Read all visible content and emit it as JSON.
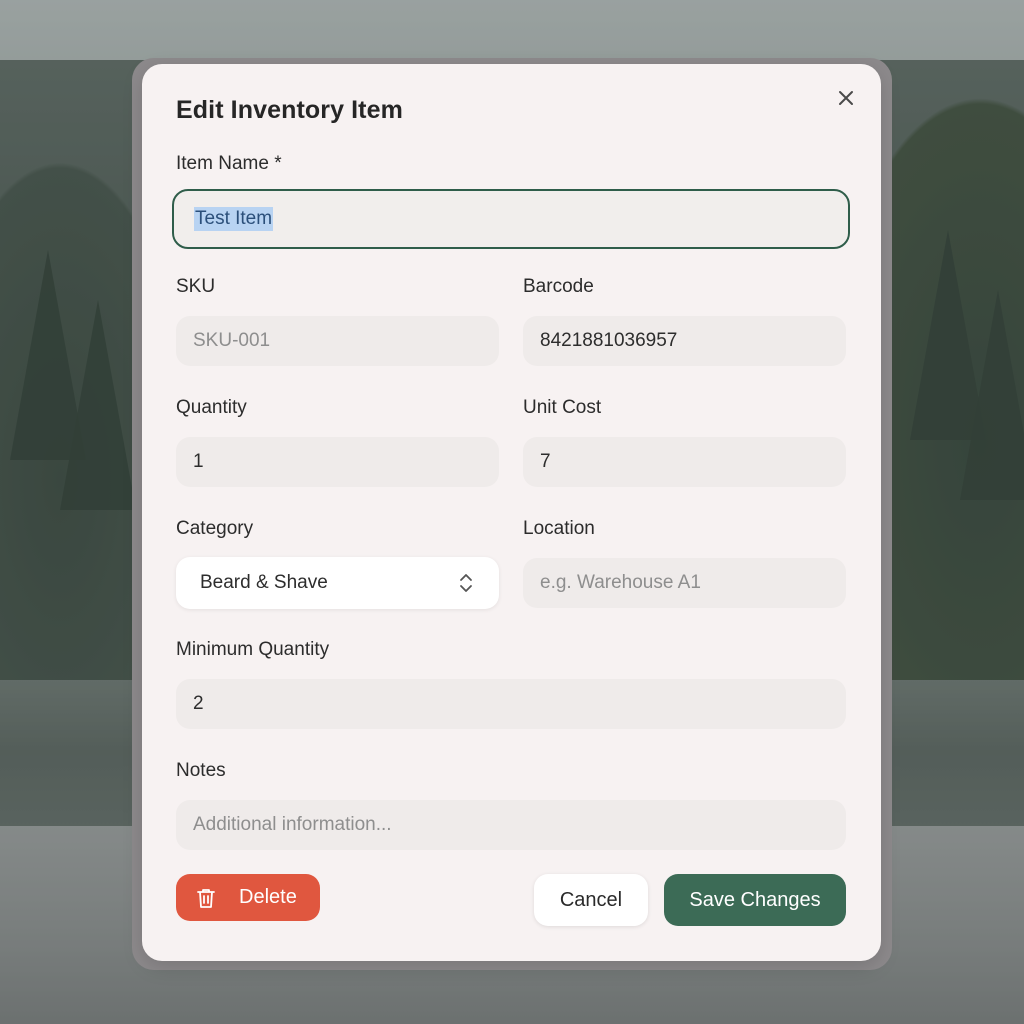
{
  "dialog": {
    "title": "Edit Inventory Item",
    "close_icon": "close-icon"
  },
  "fields": {
    "item_name": {
      "label": "Item Name *",
      "value": "Test Item",
      "state": "focused, text selected"
    },
    "sku": {
      "label": "SKU",
      "placeholder": "SKU-001"
    },
    "barcode": {
      "label": "Barcode",
      "value": "8421881036957"
    },
    "quantity": {
      "label": "Quantity",
      "value": "1"
    },
    "unit_cost": {
      "label": "Unit Cost",
      "value": "7"
    },
    "category": {
      "label": "Category",
      "value": "Beard & Shave",
      "icon": "chevron-up-down-icon"
    },
    "location": {
      "label": "Location",
      "placeholder": "e.g. Warehouse A1"
    },
    "minimum_quantity": {
      "label": "Minimum Quantity",
      "value": "2"
    },
    "notes": {
      "label": "Notes",
      "placeholder": "Additional information..."
    }
  },
  "actions": {
    "delete_label": "Delete",
    "delete_icon": "trash-icon",
    "cancel_label": "Cancel",
    "save_label": "Save Changes"
  },
  "colors": {
    "accent": "#3c6b56",
    "danger": "#e0573f",
    "focus_border": "#2f5d4a",
    "text_selection": "#b8d3f2",
    "modal_bg": "#f7f2f2",
    "field_bg": "#efebea"
  }
}
